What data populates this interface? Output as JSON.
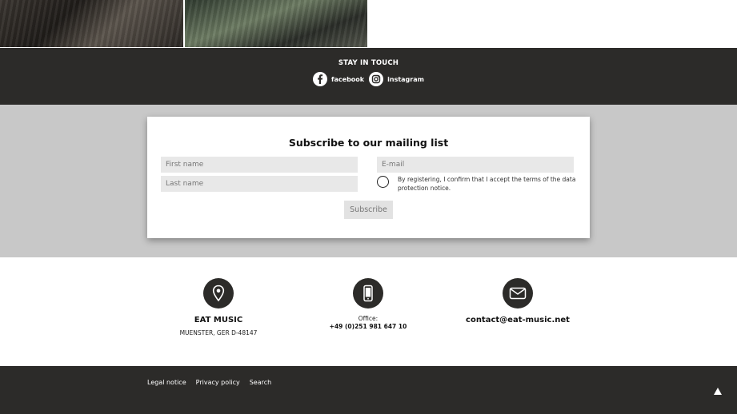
{
  "social": {
    "title": "STAY IN TOUCH",
    "links": [
      {
        "label": "facebook",
        "icon": "facebook-icon"
      },
      {
        "label": "instagram",
        "icon": "instagram-icon"
      }
    ]
  },
  "subscribe": {
    "title": "Subscribe to our mailing list",
    "first_name_placeholder": "First name",
    "last_name_placeholder": "Last name",
    "email_placeholder": "E-mail",
    "consent_text": "By registering, I confirm that I accept the terms of the data protection notice.",
    "button_label": "Subscribe"
  },
  "contact": {
    "address": {
      "icon": "location-pin-icon",
      "name": "EAT MUSIC",
      "line": "MUENSTER, GER D-48147"
    },
    "phone": {
      "icon": "smartphone-icon",
      "label": "Office:",
      "number": "+49 (0)251 981 647 10"
    },
    "mail": {
      "icon": "envelope-icon",
      "email": "contact@eat-music.net"
    }
  },
  "footer": {
    "links": [
      "Legal notice",
      "Privacy policy",
      "Search"
    ]
  },
  "colors": {
    "dark": "#2c2b29",
    "grey_bg": "#c8c8c8",
    "field_bg": "#e8e8e8"
  }
}
